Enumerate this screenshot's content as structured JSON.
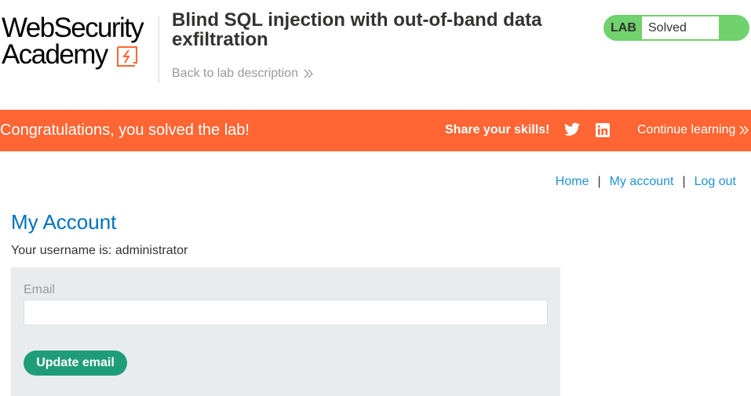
{
  "header": {
    "logo_line1": "WebSecurity",
    "logo_line2": "Academy",
    "lab_title": "Blind SQL injection with out-of-band data exfiltration",
    "back_link": "Back to lab description",
    "lab_badge": {
      "label": "LAB",
      "status": "Solved",
      "color": "#70d16d"
    }
  },
  "banner": {
    "message": "Congratulations, you solved the lab!",
    "share_label": "Share your skills!",
    "icons": [
      "twitter-icon",
      "linkedin-icon"
    ],
    "continue_label": "Continue learning",
    "color": "#ff6633"
  },
  "nav": {
    "home": "Home",
    "separator": "|",
    "my_account": "My account",
    "log_out": "Log out"
  },
  "main": {
    "title": "My Account",
    "username_text": "Your username is: administrator"
  },
  "form": {
    "email_label": "Email",
    "email_value": "",
    "submit_label": "Update email",
    "button_color": "#1f9d78"
  }
}
